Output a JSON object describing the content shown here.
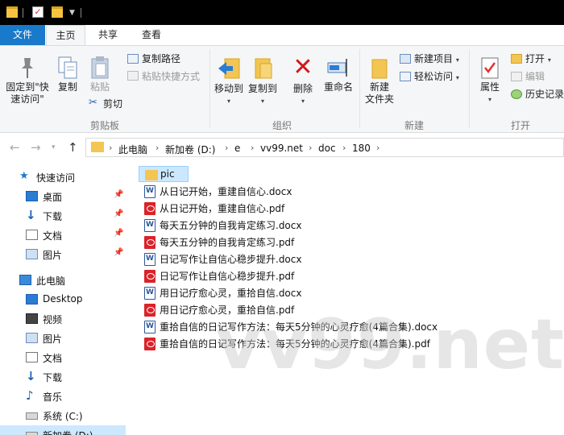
{
  "tabs": {
    "file": "文件",
    "home": "主页",
    "share": "共享",
    "view": "查看"
  },
  "ribbon": {
    "clipboard": {
      "group": "剪贴板",
      "pin": "固定到\"快\n速访问\"",
      "copy": "复制",
      "paste": "粘贴",
      "copy_path": "复制路径",
      "paste_shortcut": "粘贴快捷方式",
      "cut": "剪切"
    },
    "organize": {
      "group": "组织",
      "move_to": "移动到",
      "copy_to": "复制到",
      "delete": "删除",
      "rename": "重命名"
    },
    "new": {
      "group": "新建",
      "new_folder": "新建\n文件夹",
      "new_item": "新建项目",
      "easy_access": "轻松访问"
    },
    "open": {
      "group": "打开",
      "properties": "属性",
      "open": "打开",
      "edit": "编辑",
      "history": "历史记录"
    }
  },
  "address": {
    "crumbs": [
      "此电脑",
      "新加卷 (D:)",
      "e",
      "vv99.net",
      "doc",
      "180"
    ]
  },
  "sidebar": {
    "quick_access": "快速访问",
    "items": [
      {
        "label": "桌面",
        "pinned": true
      },
      {
        "label": "下载",
        "pinned": true
      },
      {
        "label": "文档",
        "pinned": true
      },
      {
        "label": "图片",
        "pinned": true
      }
    ],
    "this_pc": "此电脑",
    "pc_items": [
      {
        "label": "Desktop"
      },
      {
        "label": "视频"
      },
      {
        "label": "图片"
      },
      {
        "label": "文档"
      },
      {
        "label": "下载"
      },
      {
        "label": "音乐"
      },
      {
        "label": "系统 (C:)"
      },
      {
        "label": "新加卷 (D:)"
      }
    ]
  },
  "files": [
    {
      "name": "pic",
      "type": "folder"
    },
    {
      "name": "从日记开始，重建自信心.docx",
      "type": "docx"
    },
    {
      "name": "从日记开始，重建自信心.pdf",
      "type": "pdf"
    },
    {
      "name": "每天五分钟的自我肯定练习.docx",
      "type": "docx"
    },
    {
      "name": "每天五分钟的自我肯定练习.pdf",
      "type": "pdf"
    },
    {
      "name": "日记写作让自信心稳步提升.docx",
      "type": "docx"
    },
    {
      "name": "日记写作让自信心稳步提升.pdf",
      "type": "pdf"
    },
    {
      "name": "用日记疗愈心灵，重拾自信.docx",
      "type": "docx"
    },
    {
      "name": "用日记疗愈心灵，重拾自信.pdf",
      "type": "pdf"
    },
    {
      "name": "重拾自信的日记写作方法：每天5分钟的心灵疗愈(4篇合集).docx",
      "type": "docx"
    },
    {
      "name": "重拾自信的日记写作方法：每天5分钟的心灵疗愈(4篇合集).pdf",
      "type": "pdf"
    }
  ],
  "watermark": "vv99.net",
  "colors": {
    "accent": "#1979ca",
    "selection": "#cce8ff",
    "folder": "#f3c552",
    "pdf": "#d9232a"
  }
}
